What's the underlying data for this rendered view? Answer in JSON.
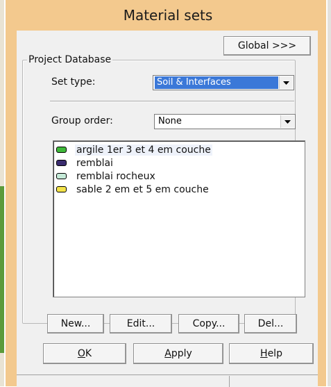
{
  "window": {
    "title": "Material sets"
  },
  "toolbar": {
    "global_label": "Global >>>"
  },
  "project_database": {
    "legend": "Project Database",
    "set_type": {
      "label": "Set type:",
      "value": "Soil & Interfaces"
    },
    "group_order": {
      "label": "Group order:",
      "value": "None"
    },
    "materials": [
      {
        "name": "argile 1er 3 et 4 em couche",
        "color": "#3fb93a",
        "selected": true
      },
      {
        "name": "remblai",
        "color": "#3a2c6e",
        "selected": false
      },
      {
        "name": "remblai rocheux",
        "color": "#c5ead8",
        "selected": false
      },
      {
        "name": "sable 2 em et 5 em couche",
        "color": "#f3e34a",
        "selected": false
      }
    ],
    "actions": {
      "new_label": "New...",
      "edit_label": "Edit...",
      "copy_label": "Copy...",
      "delete_label": "Del..."
    }
  },
  "footer": {
    "ok_mnemonic": "O",
    "ok_rest": "K",
    "apply_mnemonic": "A",
    "apply_rest": "pply",
    "help_mnemonic": "H",
    "help_rest": "elp"
  },
  "colors": {
    "dialog_frame": "#f3c98e",
    "client_bg": "#f0f0f0",
    "selection": "#3b78d8"
  },
  "icons": {
    "dropdown": "chevron-down-icon"
  }
}
